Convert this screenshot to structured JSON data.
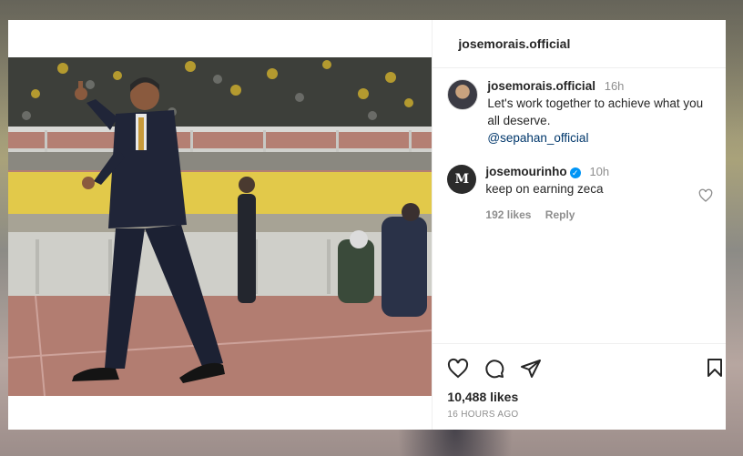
{
  "header": {
    "username": "josemorais.official"
  },
  "caption": {
    "username": "josemorais.official",
    "time": "16h",
    "text": "Let's work together to achieve what you all deserve.",
    "mention": "@sepahan_official"
  },
  "comment": {
    "username": "josemourinho",
    "verified": true,
    "time": "10h",
    "text": "keep on earning zeca",
    "likes": "192 likes",
    "reply": "Reply",
    "avatar_initials": "M"
  },
  "footer": {
    "likes": "10,488 likes",
    "time_ago": "16 HOURS AGO"
  },
  "icons": [
    "heart-icon",
    "comment-icon",
    "share-icon",
    "bookmark-icon"
  ],
  "colors": {
    "text": "#262626",
    "secondary": "#8e8e8e",
    "link": "#00376b",
    "verified": "#0095f6"
  }
}
